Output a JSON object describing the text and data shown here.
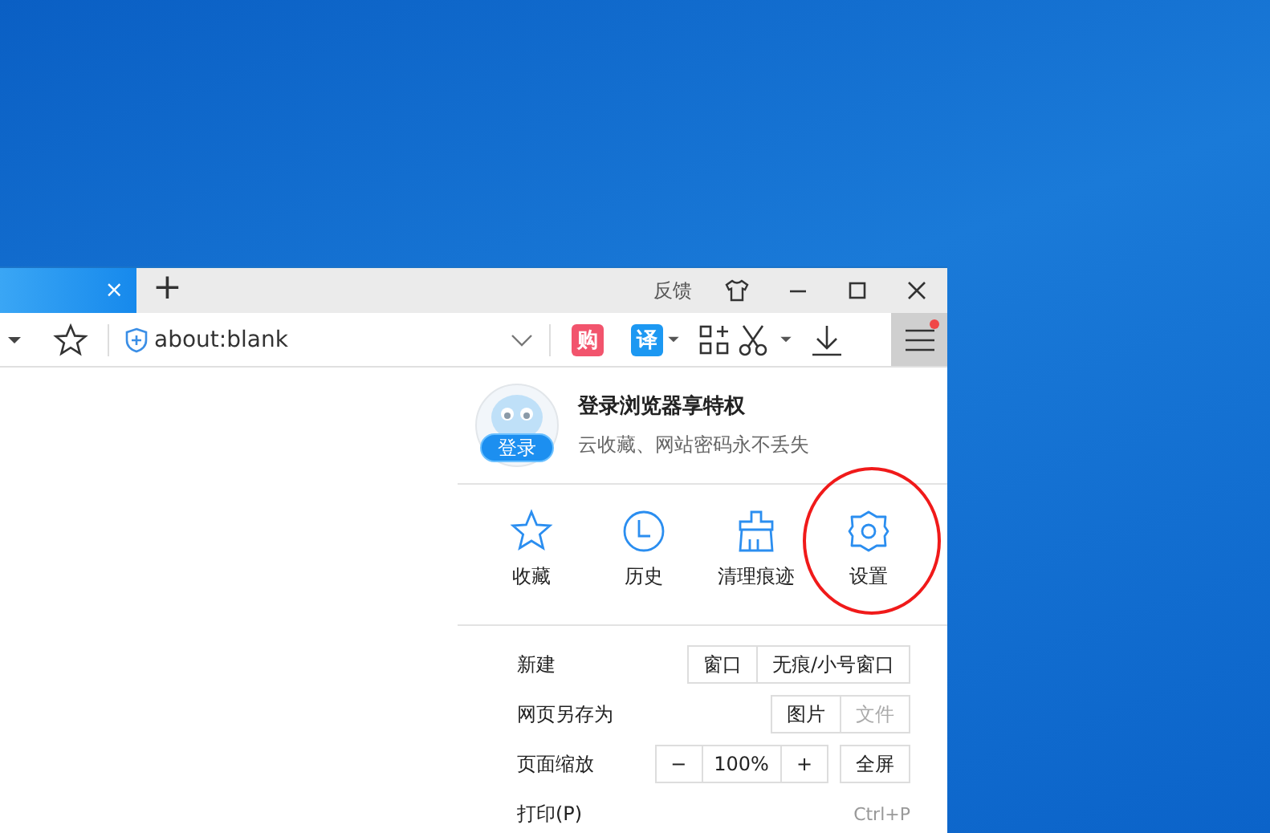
{
  "titlebar": {
    "tab_close": "×",
    "new_tab": "+",
    "feedback": "反馈"
  },
  "toolbar": {
    "url": "about:blank",
    "shop_badge": "购",
    "translate_badge": "译",
    "menu_has_notice": true
  },
  "menu": {
    "login": {
      "badge": "登录",
      "title": "登录浏览器享特权",
      "subtitle": "云收藏、网站密码永不丢失"
    },
    "shortcuts": [
      {
        "kind": "star",
        "label": "收藏",
        "highlighted": false
      },
      {
        "kind": "clock",
        "label": "历史",
        "highlighted": false
      },
      {
        "kind": "broom",
        "label": "清理痕迹",
        "highlighted": false
      },
      {
        "kind": "gear",
        "label": "设置",
        "highlighted": true
      }
    ],
    "rows": [
      {
        "label": "新建",
        "buttons": [
          {
            "label": "窗口",
            "disabled": false
          },
          {
            "label": "无痕/小号窗口",
            "disabled": false
          }
        ]
      },
      {
        "label": "网页另存为",
        "buttons": [
          {
            "label": "图片",
            "disabled": false
          },
          {
            "label": "文件",
            "disabled": true
          }
        ]
      },
      {
        "label": "页面缩放",
        "zoom": {
          "minus": "−",
          "value": "100%",
          "plus": "+"
        },
        "buttons": [
          {
            "label": "全屏",
            "disabled": false
          }
        ]
      },
      {
        "label": "打印(P)",
        "shortcut": "Ctrl+P"
      }
    ]
  }
}
